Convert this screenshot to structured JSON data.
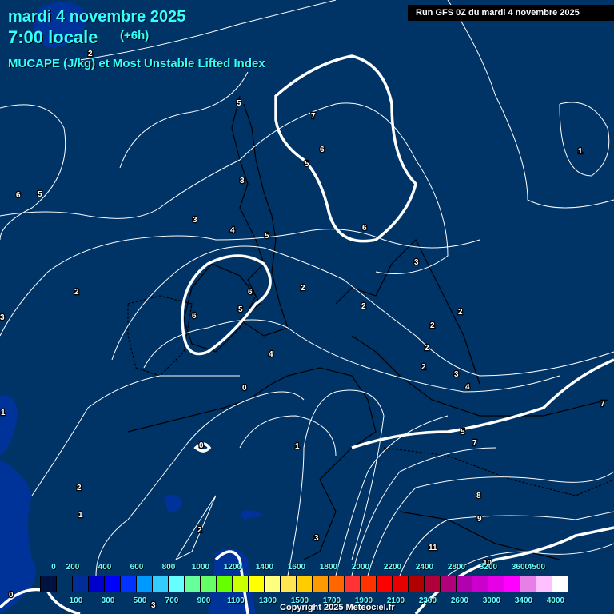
{
  "header": {
    "date": "mardi 4 novembre 2025",
    "time": "7:00 locale",
    "step": "(+6h)",
    "parameter": "MUCAPE (J/kg) et Most Unstable Lifted Index",
    "run": "Run GFS 0Z du mardi 4 novembre 2025"
  },
  "colors": {
    "background": "#003366",
    "low_cape": "#003399",
    "contour": "#ffffff",
    "coast": "#000000",
    "title": "#33ffff"
  },
  "contour_labels": [
    "2",
    "5",
    "6",
    "7",
    "6",
    "5",
    "1",
    "6",
    "5",
    "3",
    "3",
    "4",
    "5",
    "6",
    "3",
    "2",
    "6",
    "5",
    "6",
    "2",
    "2",
    "3",
    "2",
    "2",
    "4",
    "2",
    "2",
    "3",
    "4",
    "5",
    "7",
    "7",
    "0",
    "1",
    "1",
    "0",
    "2",
    "1",
    "2",
    "8",
    "9",
    "3",
    "10",
    "11",
    "0",
    "3"
  ],
  "legend": {
    "colors": [
      "#00123f",
      "#003366",
      "#002d99",
      "#0000cc",
      "#0000ff",
      "#0033ff",
      "#0099ff",
      "#33ccff",
      "#66ffff",
      "#66ff99",
      "#66ff66",
      "#66ff00",
      "#ccff00",
      "#ffff00",
      "#ffff80",
      "#ffe650",
      "#ffcc00",
      "#ff9900",
      "#ff6600",
      "#ff3333",
      "#ff3300",
      "#ff0000",
      "#e60000",
      "#b00000",
      "#b0003a",
      "#b0007a",
      "#b000b0",
      "#cc00cc",
      "#e600e6",
      "#ff00ff",
      "#e680e6",
      "#ffc0ff",
      "#ffffff"
    ],
    "top_labels": [
      "0",
      "200",
      "400",
      "600",
      "800",
      "1000",
      "1200",
      "1400",
      "1600",
      "1800",
      "2000",
      "2200",
      "2400",
      "2800",
      "3200",
      "3600",
      "4500"
    ],
    "bottom_labels": [
      "100",
      "300",
      "500",
      "700",
      "900",
      "1100",
      "1300",
      "1500",
      "1700",
      "1900",
      "2100",
      "2300",
      "2600",
      "3000",
      "3400",
      "4000"
    ]
  },
  "copyright": "Copyright 2025 Meteociel.fr"
}
